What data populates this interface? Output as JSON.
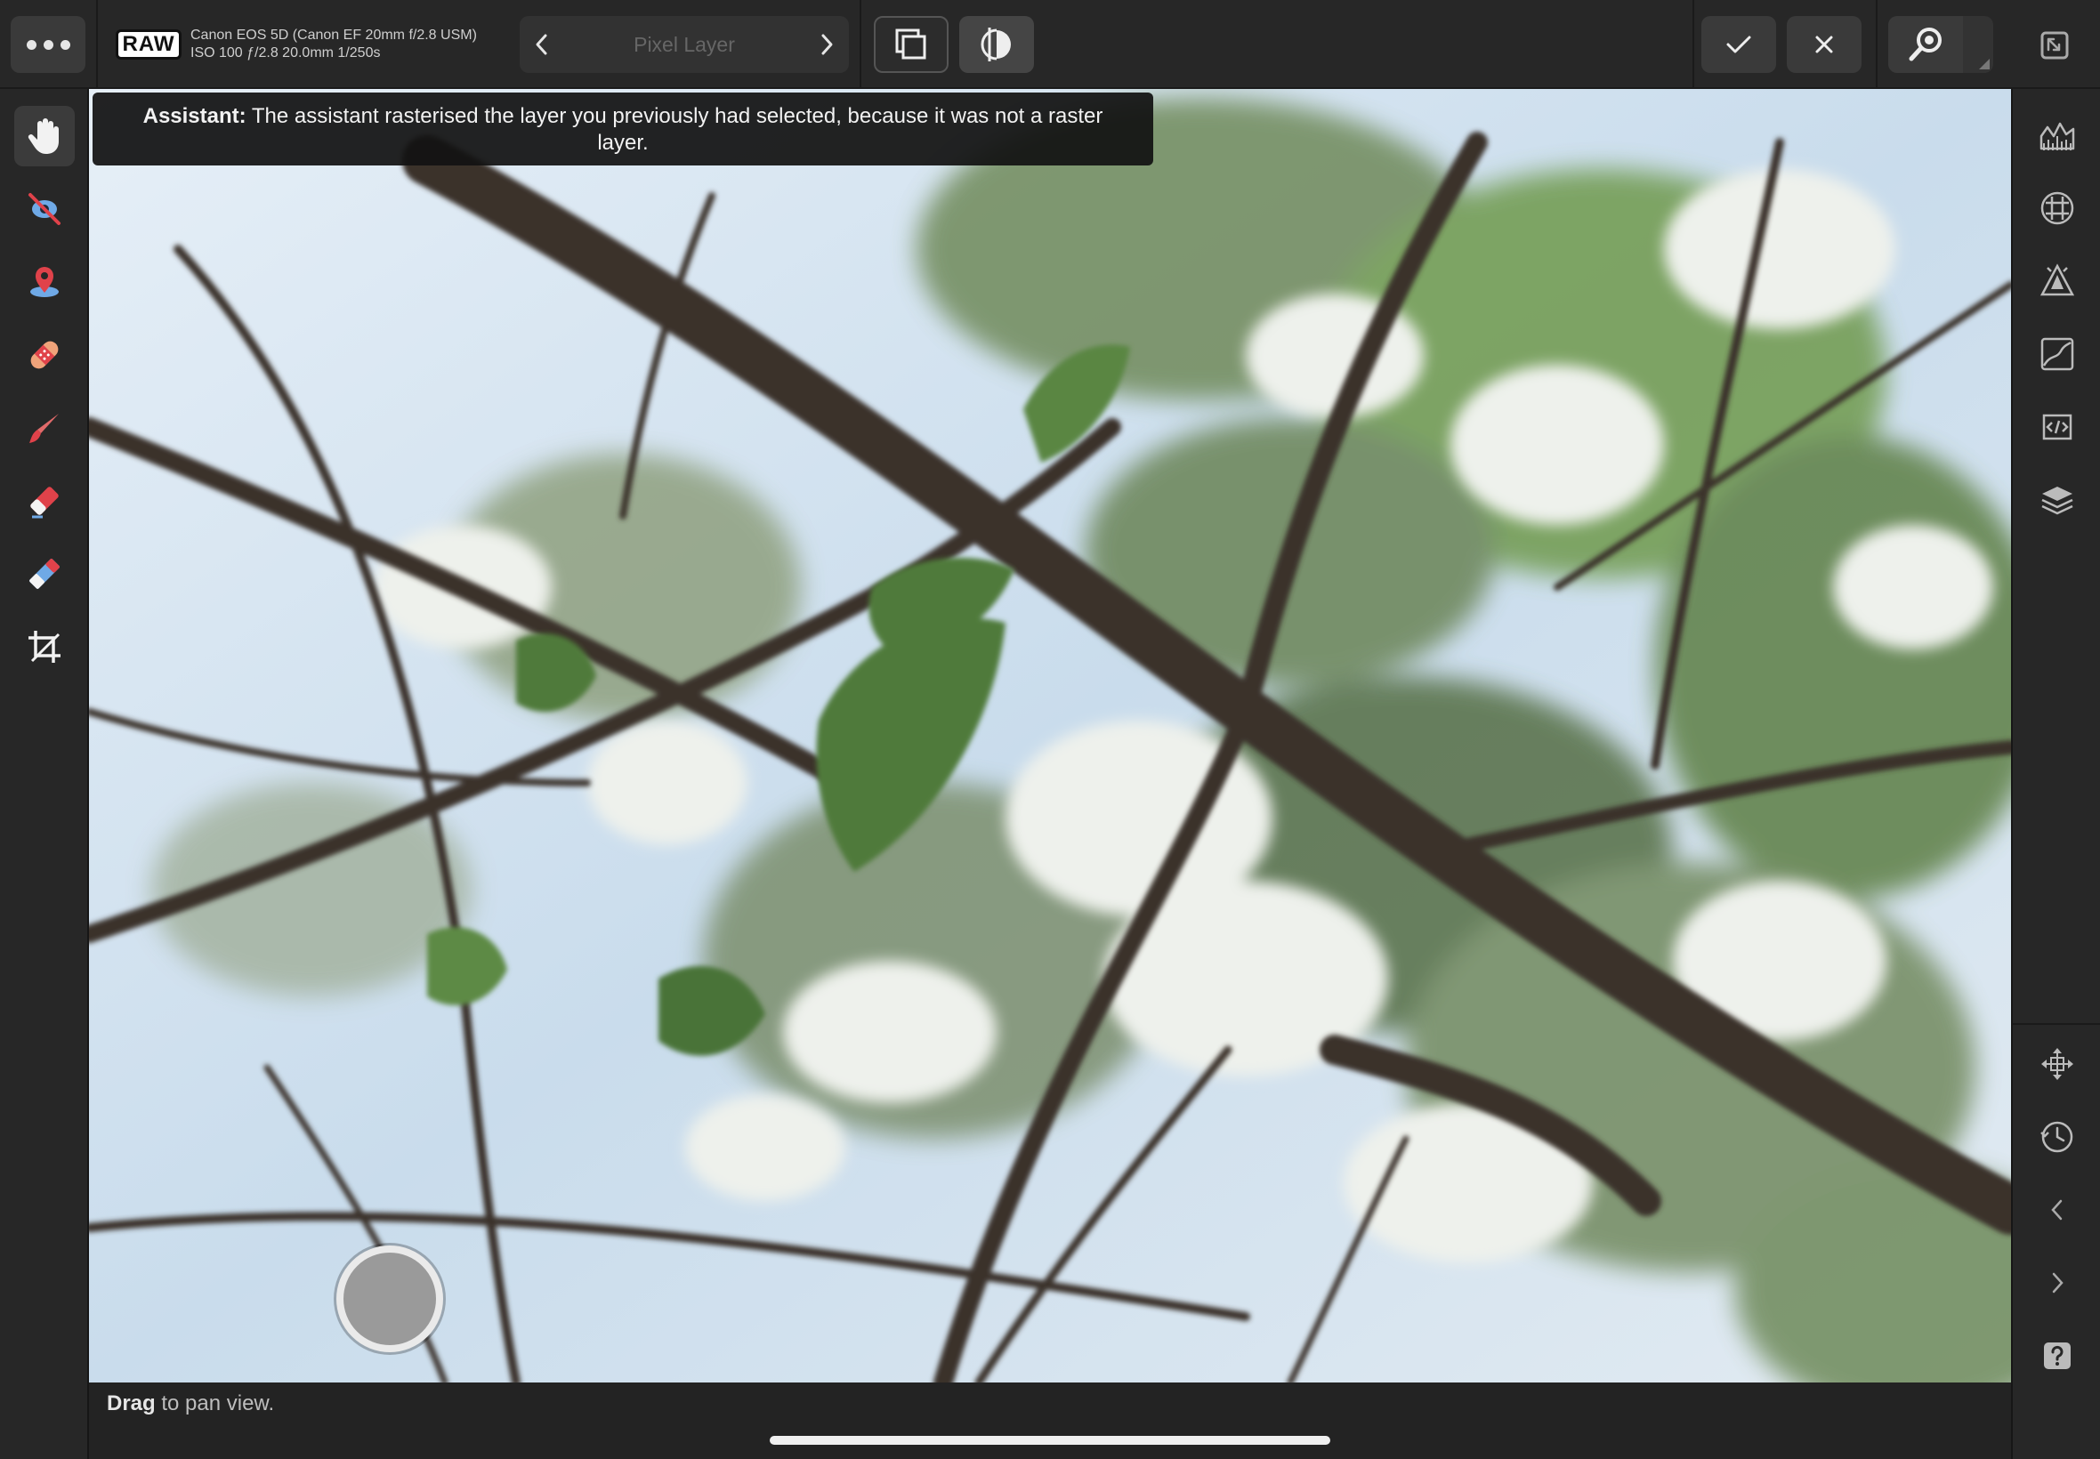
{
  "topbar": {
    "raw_badge": "RAW",
    "camera_model": "Canon EOS 5D (Canon EF 20mm f/2.8 USM)",
    "camera_settings": "ISO 100 ƒ/2.8 20.0mm 1/250s",
    "layer_name": "Pixel Layer",
    "icons": {
      "more": "more-dots-icon",
      "prev": "chevron-left-icon",
      "next": "chevron-right-icon",
      "duplicate": "duplicate-layers-icon",
      "compare": "split-compare-icon",
      "apply": "checkmark-icon",
      "cancel": "close-icon",
      "zoom": "magnifier-icon",
      "fullscreen": "fullscreen-icon"
    }
  },
  "left_tools": [
    {
      "id": "view",
      "icon": "hand-icon",
      "active": true
    },
    {
      "id": "red-eye",
      "icon": "red-eye-icon"
    },
    {
      "id": "blemish",
      "icon": "blemish-removal-icon"
    },
    {
      "id": "patch",
      "icon": "bandage-icon"
    },
    {
      "id": "brush",
      "icon": "brush-icon"
    },
    {
      "id": "erase",
      "icon": "eraser-icon"
    },
    {
      "id": "gradient",
      "icon": "overlay-gradient-icon"
    },
    {
      "id": "crop",
      "icon": "crop-icon"
    }
  ],
  "right_tools": [
    {
      "id": "histogram",
      "icon": "histogram-icon"
    },
    {
      "id": "lens",
      "icon": "lens-grid-icon"
    },
    {
      "id": "tone",
      "icon": "tone-mapping-icon"
    },
    {
      "id": "curves",
      "icon": "curves-icon"
    },
    {
      "id": "presets",
      "icon": "code-brackets-icon"
    },
    {
      "id": "layers",
      "icon": "layers-icon"
    },
    {
      "id": "transform",
      "icon": "move-arrows-icon"
    },
    {
      "id": "history",
      "icon": "history-clock-icon"
    },
    {
      "id": "undo",
      "icon": "chevron-left-icon"
    },
    {
      "id": "redo",
      "icon": "chevron-right-icon"
    },
    {
      "id": "help",
      "icon": "help-icon"
    }
  ],
  "assistant": {
    "label": "Assistant:",
    "message": "The assistant rasterised the layer you previously had selected, because it was not a raster layer."
  },
  "status": {
    "action": "Drag",
    "text": "to pan view."
  },
  "colors": {
    "toolbar_bg": "#272727",
    "button_bg": "#3a3a3a",
    "accent_red": "#e0424a",
    "accent_blue": "#6fa9e6",
    "sky": "#cfe3f2",
    "branch": "#3b302b",
    "leaf": "#4f7a3a",
    "blossom": "#eef1ec"
  }
}
